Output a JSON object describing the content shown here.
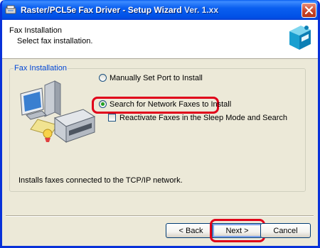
{
  "window": {
    "title": "Raster/PCL5e Fax Driver - Setup Wizard",
    "title_suffix": "Ver. 1.xx",
    "close_icon": "close-icon"
  },
  "header": {
    "title": "Fax Installation",
    "subtitle": "Select fax installation."
  },
  "group": {
    "legend": "Fax Installation",
    "options": [
      {
        "label": "Manually Set Port to Install",
        "selected": false
      },
      {
        "label": "Search for Network Faxes to Install",
        "selected": true
      }
    ],
    "checkbox": {
      "label": "Reactivate Faxes in the Sleep Mode and Search",
      "checked": false
    },
    "description": "Installs faxes connected to the TCP/IP network."
  },
  "buttons": {
    "back": "< Back",
    "next": "Next >",
    "cancel": "Cancel"
  },
  "colors": {
    "titlebar": "#0a5ff0",
    "highlight": "#e0001a",
    "legend": "#0046d5"
  }
}
